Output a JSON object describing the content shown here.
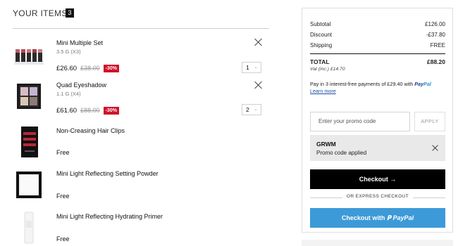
{
  "header": {
    "title": "YOUR ITEMS",
    "count": "3"
  },
  "items": [
    {
      "name": "Mini Multiple Set",
      "sub": "3.5 G (X3)",
      "price": "£26.60",
      "was": "£38.00",
      "discount": "-30%",
      "qty": "1"
    },
    {
      "name": "Quad Eyeshadow",
      "sub": "1.1 G (X4)",
      "price": "£61.60",
      "was": "£88.00",
      "discount": "-30%",
      "qty": "2"
    },
    {
      "name": "Non-Creasing Hair Clips",
      "price": "Free"
    },
    {
      "name": "Mini Light Reflecting Setting Powder",
      "price": "Free"
    },
    {
      "name": "Mini Light Reflecting Hydrating Primer",
      "price": "Free"
    }
  ],
  "summary": {
    "subtotal_label": "Subtotal",
    "subtotal_value": "£126.00",
    "discount_label": "Discount",
    "discount_value": "-£37.80",
    "shipping_label": "Shipping",
    "shipping_value": "FREE",
    "total_label": "TOTAL",
    "total_value": "£88.20",
    "vat": "Vat (inc.)  £14.70",
    "paypal_text": "Pay in 3 interest-free payments of £29.40 with",
    "paypal_brand_a": "Pay",
    "paypal_brand_b": "Pal",
    "learn_more": "Learn more",
    "promo_placeholder": "Enter your promo code",
    "apply": "APPLY",
    "promo_code": "GRWM",
    "promo_msg": "Promo code applied",
    "checkout": "Checkout →",
    "or_express": "OR EXPRESS CHECKOUT",
    "paypal_checkout_prefix": "Checkout with",
    "paypal_checkout_brand": "PayPal"
  },
  "colors": {
    "discount_red": "#d0112b",
    "paypal_blue": "#3d9ad8",
    "checkout_black": "#000000"
  }
}
